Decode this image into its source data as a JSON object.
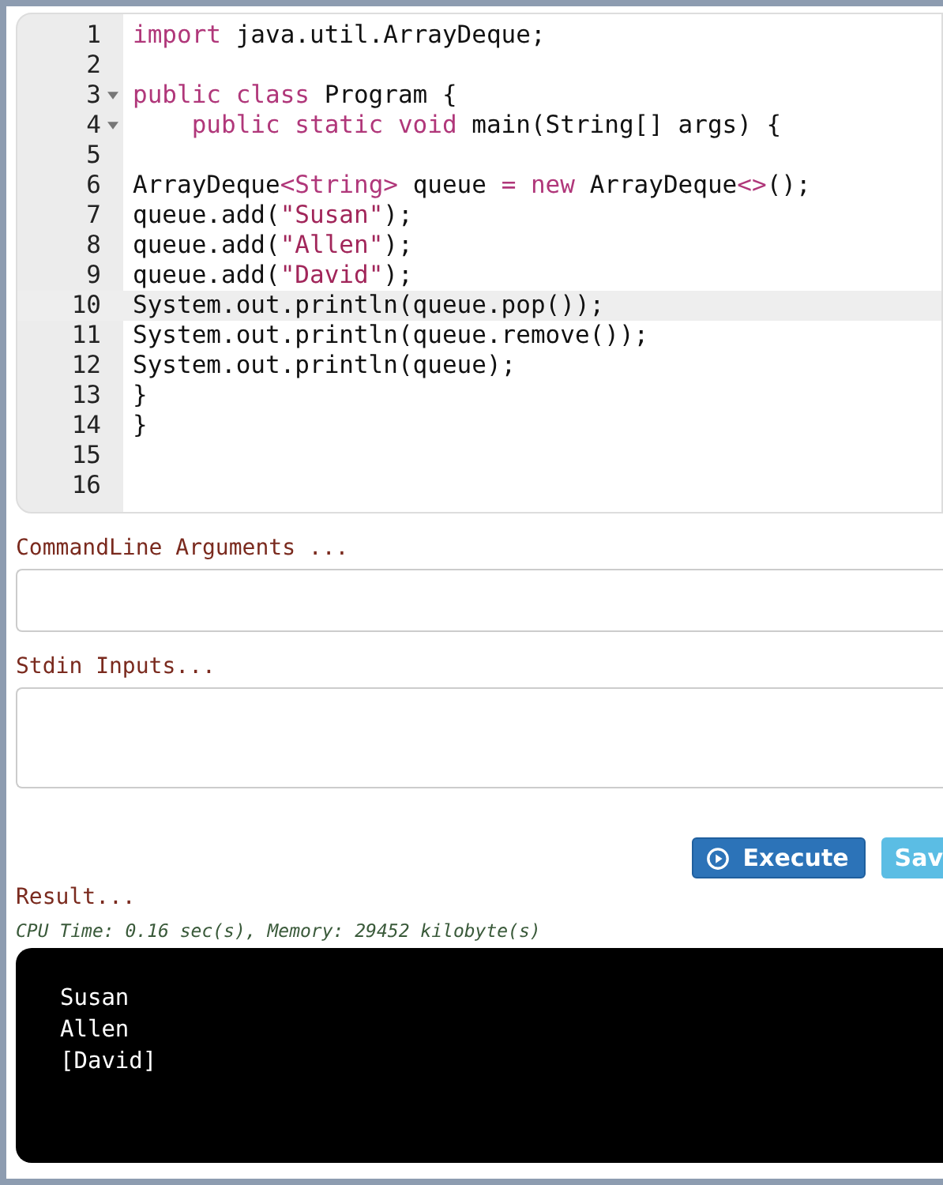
{
  "editor": {
    "lines": [
      {
        "number": "1",
        "fold": false,
        "selected": false,
        "tokens": [
          {
            "text": "import",
            "kind": "keyword"
          },
          {
            "text": " java.util.ArrayDeque;",
            "kind": "plain"
          }
        ]
      },
      {
        "number": "2",
        "fold": false,
        "selected": false
      },
      {
        "number": "3",
        "fold": true,
        "selected": false,
        "tokens": [
          {
            "text": "public class",
            "kind": "keyword"
          },
          {
            "text": " Program {",
            "kind": "plain"
          }
        ]
      },
      {
        "number": "4",
        "fold": true,
        "selected": false,
        "tokens": [
          {
            "text": "    public static void",
            "kind": "keyword"
          },
          {
            "text": " main(String[] args) {",
            "kind": "plain"
          }
        ]
      },
      {
        "number": "5",
        "fold": false,
        "selected": false
      },
      {
        "number": "6",
        "fold": false,
        "selected": false,
        "tokens": [
          {
            "text": "ArrayDeque",
            "kind": "plain"
          },
          {
            "text": "<String>",
            "kind": "keyword"
          },
          {
            "text": " queue ",
            "kind": "plain"
          },
          {
            "text": "= new",
            "kind": "keyword"
          },
          {
            "text": " ArrayDeque",
            "kind": "plain"
          },
          {
            "text": "<>",
            "kind": "keyword"
          },
          {
            "text": "();",
            "kind": "plain"
          }
        ]
      },
      {
        "number": "7",
        "fold": false,
        "selected": false,
        "tokens": [
          {
            "text": "queue.add(",
            "kind": "plain"
          },
          {
            "text": "\"Susan\"",
            "kind": "string"
          },
          {
            "text": ");",
            "kind": "plain"
          }
        ]
      },
      {
        "number": "8",
        "fold": false,
        "selected": false,
        "tokens": [
          {
            "text": "queue.add(",
            "kind": "plain"
          },
          {
            "text": "\"Allen\"",
            "kind": "string"
          },
          {
            "text": ");",
            "kind": "plain"
          }
        ]
      },
      {
        "number": "9",
        "fold": false,
        "selected": false,
        "tokens": [
          {
            "text": "queue.add(",
            "kind": "plain"
          },
          {
            "text": "\"David\"",
            "kind": "string"
          },
          {
            "text": ");",
            "kind": "plain"
          }
        ]
      },
      {
        "number": "10",
        "fold": false,
        "selected": true,
        "tokens": [
          {
            "text": "System.out.println(queue.pop());",
            "kind": "plain"
          }
        ]
      },
      {
        "number": "11",
        "fold": false,
        "selected": false,
        "tokens": [
          {
            "text": "System.out.println(queue.remove());",
            "kind": "plain"
          }
        ]
      },
      {
        "number": "12",
        "fold": false,
        "selected": false,
        "tokens": [
          {
            "text": "System.out.println(queue);",
            "kind": "plain"
          }
        ]
      },
      {
        "number": "13",
        "fold": false,
        "selected": false,
        "tokens": [
          {
            "text": "}",
            "kind": "plain"
          }
        ]
      },
      {
        "number": "14",
        "fold": false,
        "selected": false,
        "tokens": [
          {
            "text": "}",
            "kind": "plain"
          }
        ]
      },
      {
        "number": "15",
        "fold": false,
        "selected": false
      },
      {
        "number": "16",
        "fold": false,
        "selected": false
      }
    ]
  },
  "args_label": "CommandLine Arguments ...",
  "stdin_label": "Stdin Inputs...",
  "buttons": [
    {
      "label": "Execute",
      "kind": "primary"
    },
    {
      "label": "Sav",
      "kind": "secondary"
    }
  ],
  "result_label": "Result...",
  "stats": "CPU Time: 0.16 sec(s), Memory: 29452 kilobyte(s)",
  "output": [
    "Susan",
    "Allen",
    "[David]"
  ]
}
